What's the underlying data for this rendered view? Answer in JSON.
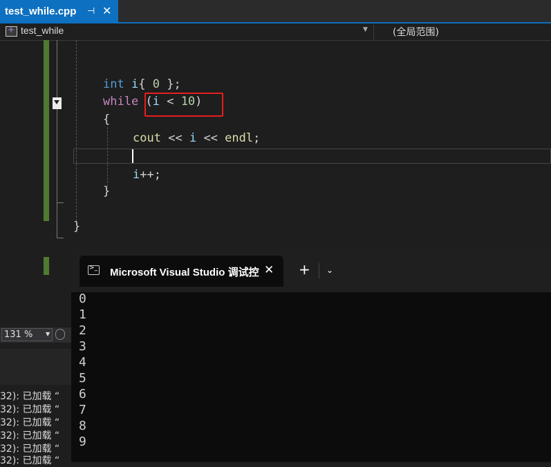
{
  "tab": {
    "filename": "test_while.cpp",
    "pin": "⊣",
    "close": "✕"
  },
  "navbar": {
    "project": "test_while",
    "scope": "(全局范围)"
  },
  "code": {
    "line1": {
      "kw": "int",
      "rest_id": "i",
      "brace_open": "{",
      "num": "0",
      "brace_close": "};"
    },
    "line2": {
      "kw": "while",
      "paren": "(",
      "id": "i",
      "op": "<",
      "num": "10",
      "paren_close": ")"
    },
    "line3": "{",
    "line4": {
      "fn": "cout",
      "op1": "<<",
      "id": "i",
      "op2": "<<",
      "endl": "endl",
      "semi": ";"
    },
    "line5": {
      "id": "i",
      "rest": "++;"
    },
    "line6": "}",
    "line7": "}"
  },
  "status": {
    "zoom": "131 %"
  },
  "output": {
    "lines": [
      "32): 已加载 “",
      "32): 已加载 “",
      "32): 已加载 “",
      "32): 已加载 “",
      "32): 已加载 “",
      "32): 已加载 “"
    ]
  },
  "terminal": {
    "title": "Microsoft Visual Studio 调试控",
    "close": "✕",
    "new_tab": "+",
    "dropdown": "⌄",
    "lines": [
      "0",
      "1",
      "2",
      "3",
      "4",
      "5",
      "6",
      "7",
      "8",
      "9"
    ]
  },
  "icons": {
    "project": "cpp-project-icon",
    "collapse": "collapse-arrow-icon",
    "terminal": "terminal-icon"
  }
}
